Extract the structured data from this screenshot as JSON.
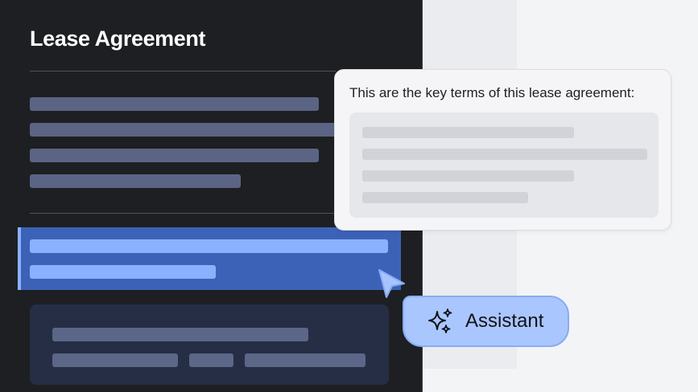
{
  "document": {
    "title": "Lease Agreement"
  },
  "popover": {
    "text": "This are the key terms of this lease agreement:"
  },
  "assistant": {
    "label": "Assistant",
    "icon": "sparkles-icon"
  },
  "colors": {
    "panel_bg": "#1e1f22",
    "highlight": "#3c62b8",
    "accent": "#8ab1ff",
    "assistant_bg": "#aac6ff"
  }
}
